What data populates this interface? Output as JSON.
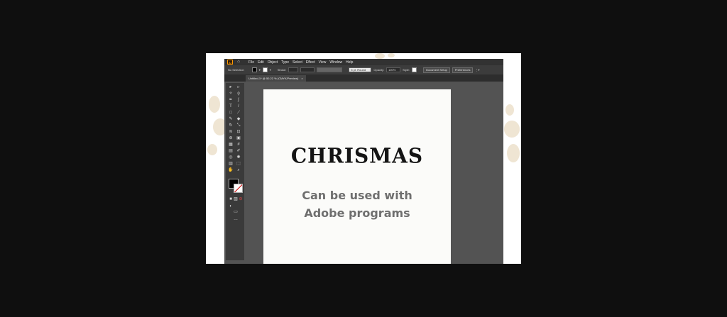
{
  "menubar": {
    "app_logo": "Ai",
    "home_icon": "home-icon",
    "items": [
      "File",
      "Edit",
      "Object",
      "Type",
      "Select",
      "Effect",
      "View",
      "Window",
      "Help"
    ]
  },
  "control_bar": {
    "selection": "No Selection",
    "stroke_label": "Stroke:",
    "brush": "5 pt. Round",
    "opacity_label": "Opacity:",
    "opacity_value": "100%",
    "style_label": "Style:",
    "document_setup": "Document Setup",
    "preferences": "Preferences"
  },
  "document_tab": {
    "title": "Untitled-1* @ 50.22 % (CMYK/Preview)",
    "close": "×"
  },
  "artboard": {
    "headline": "CHRISMAS",
    "caption_line1": "Can be used with",
    "caption_line2": "Adobe programs"
  },
  "colors": {
    "background": "#0f0f0f",
    "ui_dark": "#323232",
    "canvas": "#535353",
    "caption": "#6f6f6f"
  }
}
